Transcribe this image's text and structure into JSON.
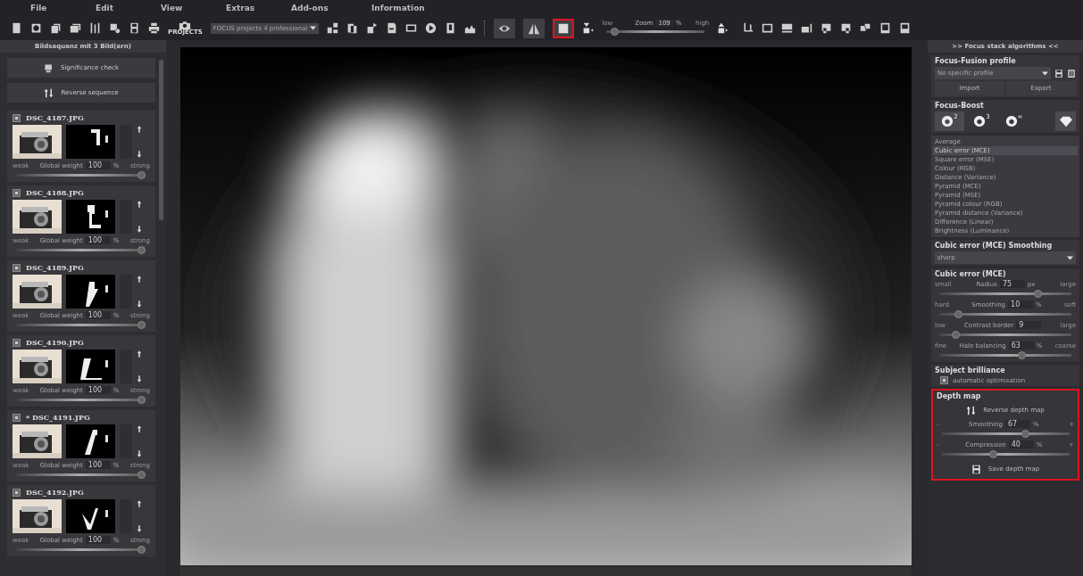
{
  "menu": [
    "File",
    "Edit",
    "View",
    "Extras",
    "Add-ons",
    "Information"
  ],
  "toolbar": {
    "camera_label": "PROJECTS",
    "project_dropdown": "FOCUS projects 4 professional",
    "view_buttons": [
      {
        "selected": true,
        "highlighted": false
      },
      {
        "selected": true,
        "highlighted": false
      },
      {
        "selected": true,
        "highlighted": true
      }
    ],
    "zoom": {
      "low": "low",
      "label": "Zoom",
      "value": "109",
      "unit": "%",
      "high": "high",
      "level": 0.05
    }
  },
  "sequence_panel": {
    "title": "Bildsequenz mit 3 Bild(ern)",
    "buttons": [
      "Significance check",
      "Reverse sequence"
    ],
    "images": [
      {
        "name": "DSC_4187.JPG",
        "checked": true,
        "weak": "weak",
        "weight_label": "Global weight",
        "weight": "100",
        "unit": "%",
        "strong": "strong",
        "level": 1
      },
      {
        "name": "DSC_4188.JPG",
        "checked": true,
        "weak": "weak",
        "weight_label": "Global weight",
        "weight": "100",
        "unit": "%",
        "strong": "strong",
        "level": 1
      },
      {
        "name": "DSC_4189.JPG",
        "checked": true,
        "weak": "weak",
        "weight_label": "Global weight",
        "weight": "100",
        "unit": "%",
        "strong": "strong",
        "level": 1
      },
      {
        "name": "DSC_4190.JPG",
        "checked": true,
        "weak": "weak",
        "weight_label": "Global weight",
        "weight": "100",
        "unit": "%",
        "strong": "strong",
        "level": 1
      },
      {
        "name": "* DSC_4191.JPG",
        "checked": true,
        "weak": "weak",
        "weight_label": "Global weight",
        "weight": "100",
        "unit": "%",
        "strong": "strong",
        "level": 1
      },
      {
        "name": "DSC_4192.JPG",
        "checked": true,
        "weak": "weak",
        "weight_label": "Global weight",
        "weight": "100",
        "unit": "%",
        "strong": "strong",
        "level": 1
      }
    ]
  },
  "algorithms_panel": {
    "title": ">> Focus stack algorithms <<",
    "profile": {
      "heading": "Focus-Fusion profile",
      "value": "No specific profile",
      "import": "Import",
      "export": "Export"
    },
    "boost": {
      "heading": "Focus-Boost",
      "buttons": [
        {
          "kind": "aperture",
          "sup": "2",
          "selected": true
        },
        {
          "kind": "aperture",
          "sup": "3",
          "selected": false
        },
        {
          "kind": "aperture",
          "sup": "∞",
          "selected": false
        },
        {
          "kind": "diamond",
          "selected": true
        }
      ]
    },
    "methods": [
      {
        "label": "Average",
        "selected": false
      },
      {
        "label": "Cubic error (MCE)",
        "selected": true
      },
      {
        "label": "Square error (MSE)",
        "selected": false
      },
      {
        "label": "Colour (RGB)",
        "selected": false
      },
      {
        "label": "Distance (Variance)",
        "selected": false
      },
      {
        "label": "Pyramid (MCE)",
        "selected": false
      },
      {
        "label": "Pyramid (MSE)",
        "selected": false
      },
      {
        "label": "Pyramid colour (RGB)",
        "selected": false
      },
      {
        "label": "Pyramid distance (Variance)",
        "selected": false
      },
      {
        "label": "Difference (Linear)",
        "selected": false
      },
      {
        "label": "Brightness (Luminance)",
        "selected": false
      }
    ],
    "smoothing": {
      "heading": "Cubic error (MCE) Smoothing",
      "value": "sharp"
    },
    "params": {
      "heading": "Cubic error (MCE)",
      "sliders": [
        {
          "min": "small",
          "label": "Radius",
          "value": "75",
          "unit": "px",
          "max": "large",
          "level": 0.76
        },
        {
          "min": "hard",
          "label": "Smoothing",
          "value": "10",
          "unit": "%",
          "max": "soft",
          "level": 0.12
        },
        {
          "min": "low",
          "label": "Contrast border",
          "value": "9",
          "max": "large",
          "level": 0.1
        },
        {
          "min": "fine",
          "label": "Halo balancing",
          "value": "63",
          "unit": "%",
          "max": "coarse",
          "level": 0.63
        }
      ]
    },
    "brilliance": {
      "heading": "Subject brilliance",
      "option": "automatic optimisation",
      "checked": true
    },
    "depth_map": {
      "heading": "Depth map",
      "highlighted": true,
      "reverse": "Reverse depth map",
      "sliders": [
        {
          "min": "-",
          "label": "Smoothing",
          "value": "67",
          "unit": "%",
          "max": "+",
          "level": 0.67
        },
        {
          "min": "-",
          "label": "Compression",
          "value": "40",
          "unit": "%",
          "max": "+",
          "level": 0.4
        }
      ],
      "save": "Save depth map"
    }
  }
}
